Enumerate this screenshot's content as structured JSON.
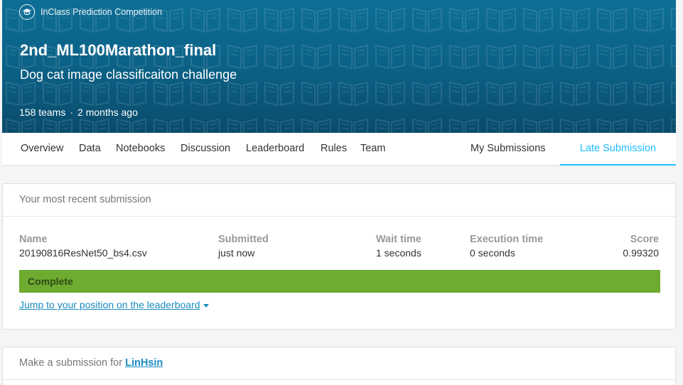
{
  "competition": {
    "type_label": "InClass Prediction Competition",
    "title": "2nd_ML100Marathon_final",
    "subtitle": "Dog cat image classificaiton challenge",
    "teams": "158 teams",
    "separator": "·",
    "age": "2 months ago"
  },
  "tabs": {
    "overview": "Overview",
    "data": "Data",
    "notebooks": "Notebooks",
    "discussion": "Discussion",
    "leaderboard": "Leaderboard",
    "rules": "Rules",
    "team": "Team",
    "my_submissions": "My Submissions",
    "late_submission": "Late Submission"
  },
  "recent": {
    "heading": "Your most recent submission",
    "columns": {
      "name": "Name",
      "submitted": "Submitted",
      "wait": "Wait time",
      "execution": "Execution time",
      "score": "Score"
    },
    "row": {
      "name": "20190816ResNet50_bs4.csv",
      "submitted": "just now",
      "wait": "1 seconds",
      "execution": "0 seconds",
      "score": "0.99320"
    },
    "status": "Complete",
    "jump_link": "Jump to your position on the leaderboard"
  },
  "make_submission": {
    "prefix": "Make a submission for",
    "user": "LinHsin"
  },
  "colors": {
    "banner": "#0b5f84",
    "accent": "#20beff",
    "complete": "#6eab31",
    "link": "#1a8bc0"
  },
  "icons": {
    "competition_type": "graduation-cap-icon",
    "jump_caret": "caret-down-icon"
  }
}
